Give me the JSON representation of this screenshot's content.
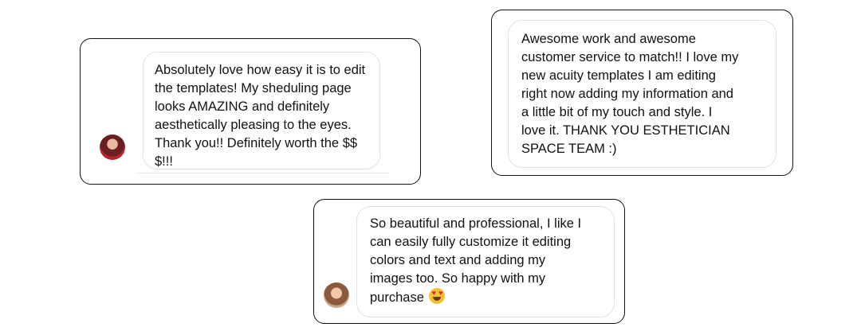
{
  "reviews": [
    {
      "text": "Absolutely love how easy it is to edit\nthe templates! My sheduling page\nlooks AMAZING and definitely\naesthetically pleasing to the eyes.\nThank you!! Definitely worth the $$\n$!!!",
      "avatar": "reviewer-avatar"
    },
    {
      "text": "Awesome work and awesome\ncustomer service to match!! I love my\nnew acuity templates I am editing\nright now adding my information and\na little bit of my touch and style. I\nlove it. THANK YOU ESTHETICIAN\nSPACE TEAM :)"
    },
    {
      "text": "So beautiful and professional, I like I\ncan easily fully customize it editing\ncolors and text and adding my\nimages too. So happy with my\npurchase",
      "emoji": "heart-eyes-emoji",
      "avatar": "reviewer-avatar"
    }
  ]
}
